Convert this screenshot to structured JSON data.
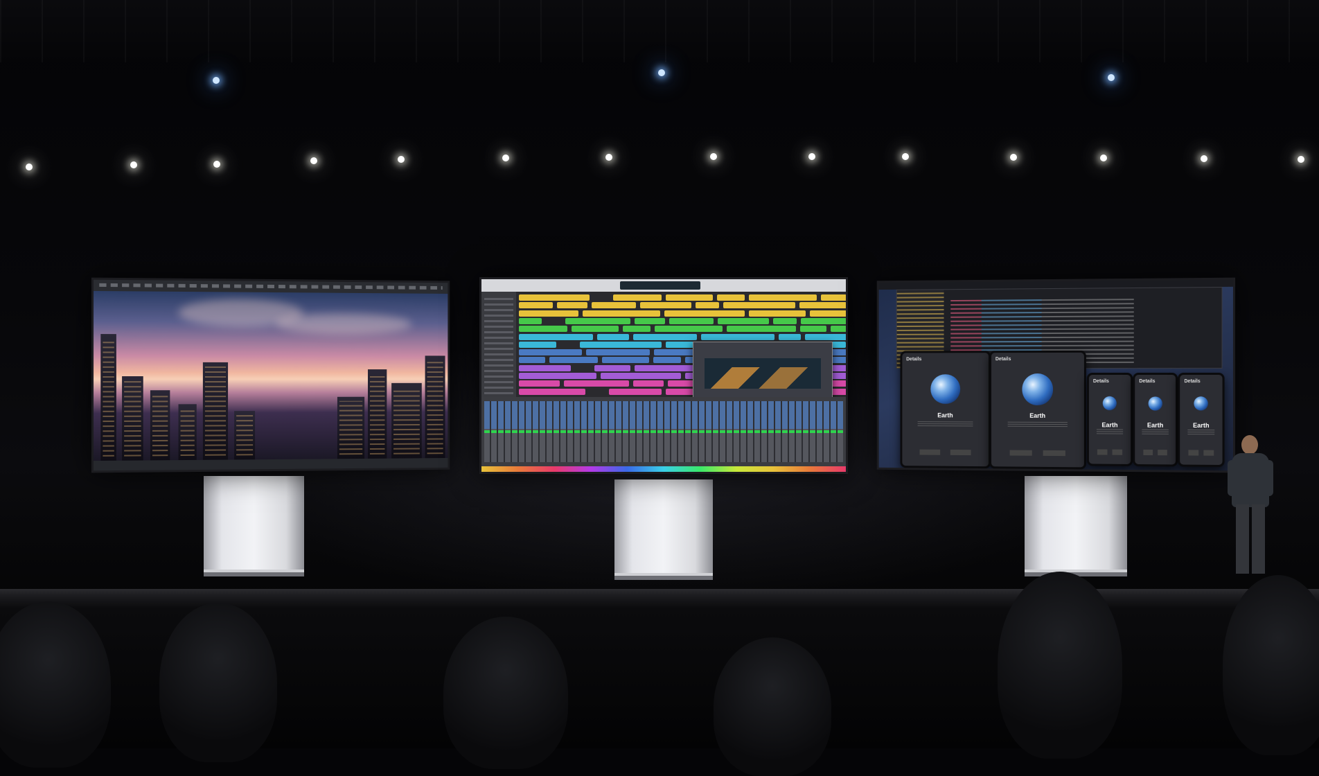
{
  "scene": {
    "description_type": "keynote-stage",
    "background_color": "#050507",
    "light_color": "#ffffff",
    "accent_light_color": "#9cc8ff"
  },
  "displays": [
    {
      "id": "photo-editor",
      "content": "city-landscape-image",
      "colors": {
        "sky_top": "#2b3d66",
        "sky_glow": "#f0b6a0",
        "water": "#c98aa5"
      }
    },
    {
      "id": "audio-workstation",
      "content": "multitrack-arrangement-with-mixer",
      "track_colors": [
        "#e8c23a",
        "#46c84a",
        "#3ab8d8",
        "#4a7ac2",
        "#a35cd6",
        "#d84aa8"
      ]
    },
    {
      "id": "code-editor",
      "content": "source-code-with-device-previews",
      "device_previews": [
        {
          "header": "Details",
          "title": "Earth"
        },
        {
          "header": "Details",
          "title": "Earth"
        },
        {
          "header": "Details",
          "title": "Earth"
        },
        {
          "header": "Details",
          "title": "Earth"
        },
        {
          "header": "Details",
          "title": "Earth"
        }
      ]
    }
  ]
}
